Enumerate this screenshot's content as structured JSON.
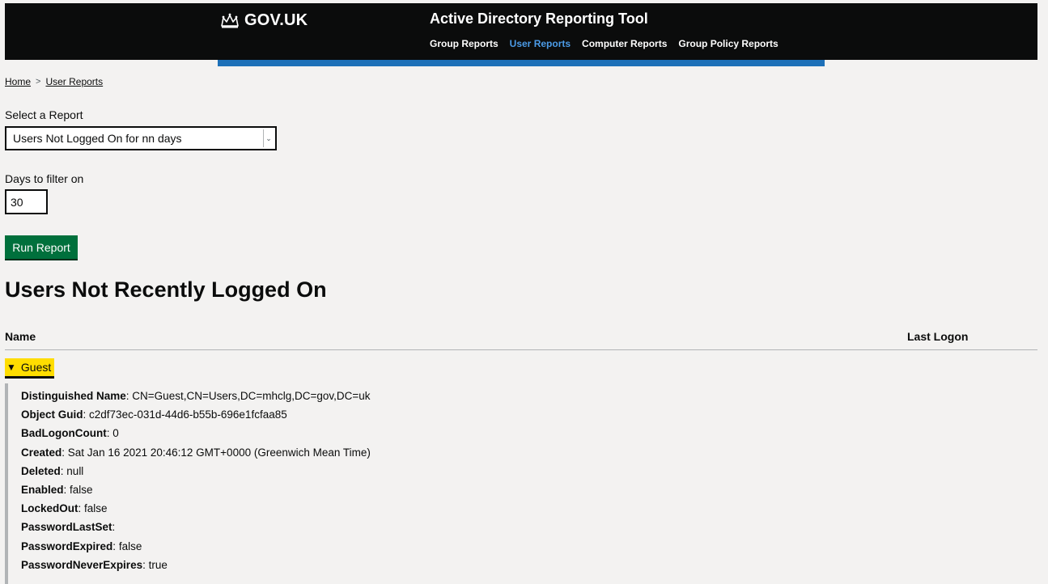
{
  "header": {
    "logo_text": "GOV.UK",
    "logo_icon": "crown-icon",
    "service_name": "Active Directory Reporting Tool",
    "nav": [
      {
        "label": "Group Reports",
        "active": false
      },
      {
        "label": "User Reports",
        "active": true
      },
      {
        "label": "Computer Reports",
        "active": false
      },
      {
        "label": "Group Policy Reports",
        "active": false
      }
    ],
    "colors": {
      "header_bg": "#0b0c0c",
      "accent_bar": "#1d70b8",
      "active_link": "#4c9ce8"
    }
  },
  "breadcrumb": {
    "items": [
      "Home",
      "User Reports"
    ],
    "separator": ">"
  },
  "form": {
    "report_label": "Select a Report",
    "report_selected": "Users Not Logged On for nn days",
    "days_label": "Days to filter on",
    "days_value": "30",
    "run_button": "Run Report",
    "button_color": "#00703c"
  },
  "report": {
    "title": "Users Not Recently Logged On",
    "columns": [
      "Name",
      "Last Logon"
    ],
    "row": {
      "name": "Guest",
      "expanded": true,
      "highlight_color": "#ffdd00",
      "details": [
        {
          "key": "Distinguished Name",
          "value": "CN=Guest,CN=Users,DC=mhclg,DC=gov,DC=uk"
        },
        {
          "key": "Object Guid",
          "value": "c2df73ec-031d-44d6-b55b-696e1fcfaa85"
        },
        {
          "key": "BadLogonCount",
          "value": "0"
        },
        {
          "key": "Created",
          "value": "Sat Jan 16 2021 20:46:12 GMT+0000 (Greenwich Mean Time)"
        },
        {
          "key": "Deleted",
          "value": "null"
        },
        {
          "key": "Enabled",
          "value": "false"
        },
        {
          "key": "LockedOut",
          "value": "false"
        },
        {
          "key": "PasswordLastSet",
          "value": ""
        },
        {
          "key": "PasswordExpired",
          "value": "false"
        },
        {
          "key": "PasswordNeverExpires",
          "value": "true"
        }
      ]
    }
  }
}
